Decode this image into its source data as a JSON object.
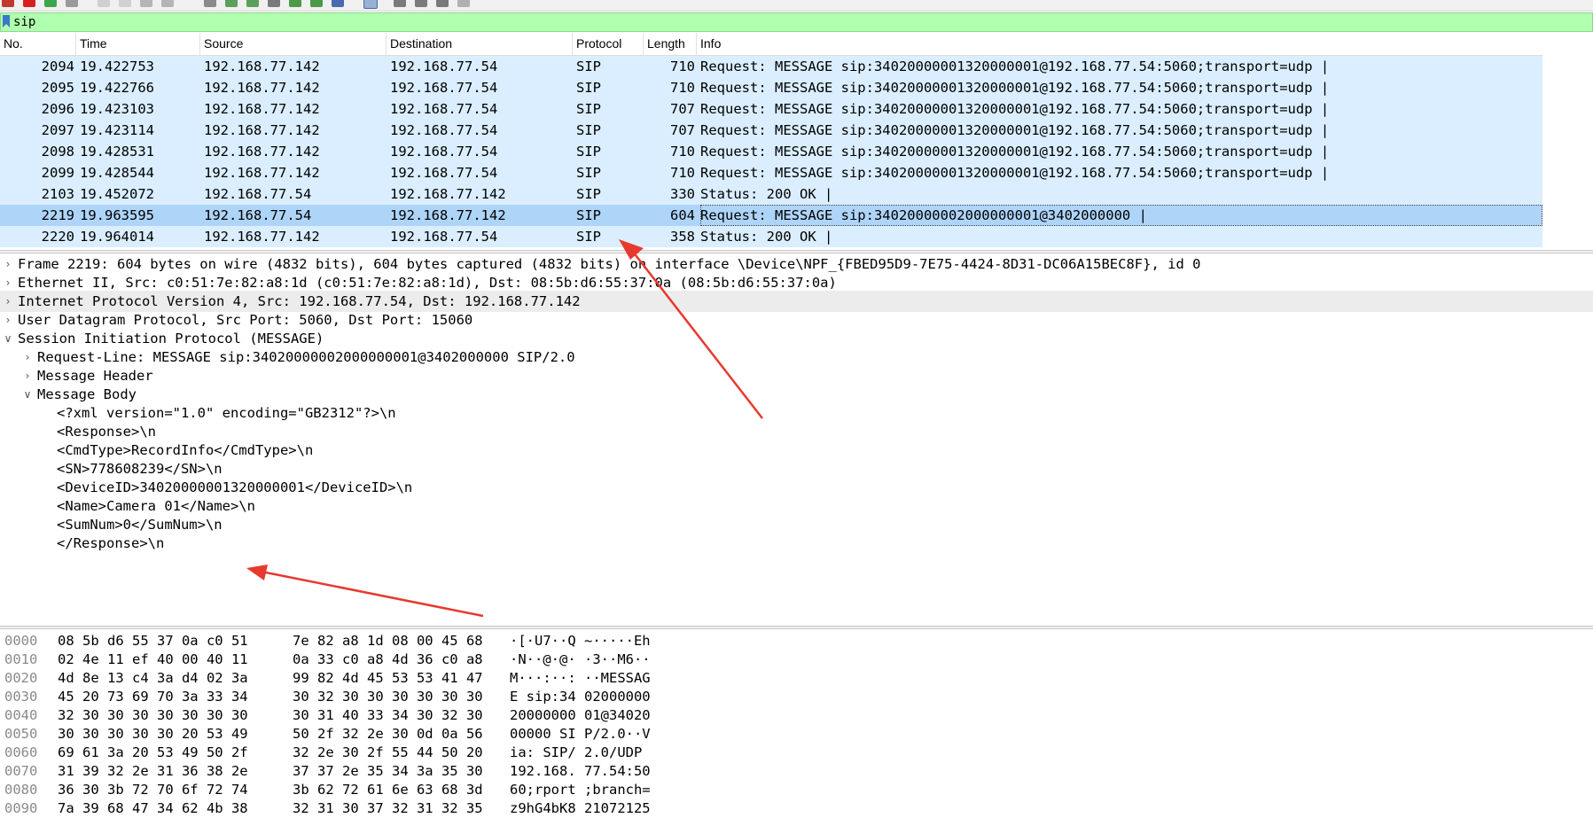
{
  "filter": {
    "value": "sip"
  },
  "packet_list": {
    "columns": [
      "No.",
      "Time",
      "Source",
      "Destination",
      "Protocol",
      "Length",
      "Info"
    ],
    "rows": [
      {
        "no": "2094",
        "time": "19.422753",
        "src": "192.168.77.142",
        "dst": "192.168.77.54",
        "proto": "SIP",
        "len": "710",
        "info": "Request: MESSAGE sip:34020000001320000001@192.168.77.54:5060;transport=udp  |"
      },
      {
        "no": "2095",
        "time": "19.422766",
        "src": "192.168.77.142",
        "dst": "192.168.77.54",
        "proto": "SIP",
        "len": "710",
        "info": "Request: MESSAGE sip:34020000001320000001@192.168.77.54:5060;transport=udp  |"
      },
      {
        "no": "2096",
        "time": "19.423103",
        "src": "192.168.77.142",
        "dst": "192.168.77.54",
        "proto": "SIP",
        "len": "707",
        "info": "Request: MESSAGE sip:34020000001320000001@192.168.77.54:5060;transport=udp  |"
      },
      {
        "no": "2097",
        "time": "19.423114",
        "src": "192.168.77.142",
        "dst": "192.168.77.54",
        "proto": "SIP",
        "len": "707",
        "info": "Request: MESSAGE sip:34020000001320000001@192.168.77.54:5060;transport=udp  |"
      },
      {
        "no": "2098",
        "time": "19.428531",
        "src": "192.168.77.142",
        "dst": "192.168.77.54",
        "proto": "SIP",
        "len": "710",
        "info": "Request: MESSAGE sip:34020000001320000001@192.168.77.54:5060;transport=udp  |"
      },
      {
        "no": "2099",
        "time": "19.428544",
        "src": "192.168.77.142",
        "dst": "192.168.77.54",
        "proto": "SIP",
        "len": "710",
        "info": "Request: MESSAGE sip:34020000001320000001@192.168.77.54:5060;transport=udp  |"
      },
      {
        "no": "2103",
        "time": "19.452072",
        "src": "192.168.77.54",
        "dst": "192.168.77.142",
        "proto": "SIP",
        "len": "330",
        "info": "Status: 200 OK  |"
      },
      {
        "no": "2219",
        "time": "19.963595",
        "src": "192.168.77.54",
        "dst": "192.168.77.142",
        "proto": "SIP",
        "len": "604",
        "info": "Request: MESSAGE sip:34020000002000000001@3402000000  |"
      },
      {
        "no": "2220",
        "time": "19.964014",
        "src": "192.168.77.142",
        "dst": "192.168.77.54",
        "proto": "SIP",
        "len": "358",
        "info": "Status: 200 OK  |"
      }
    ],
    "selected_no": "2219"
  },
  "details": {
    "lines": [
      {
        "twisty": ">",
        "text": "Frame 2219: 604 bytes on wire (4832 bits), 604 bytes captured (4832 bits) on interface \\Device\\NPF_{FBED95D9-7E75-4424-8D31-DC06A15BEC8F}, id 0"
      },
      {
        "twisty": ">",
        "text": "Ethernet II, Src: c0:51:7e:82:a8:1d (c0:51:7e:82:a8:1d), Dst: 08:5b:d6:55:37:0a (08:5b:d6:55:37:0a)"
      },
      {
        "twisty": ">",
        "text": "Internet Protocol Version 4, Src: 192.168.77.54, Dst: 192.168.77.142"
      },
      {
        "twisty": ">",
        "text": "User Datagram Protocol, Src Port: 5060, Dst Port: 15060"
      },
      {
        "twisty": "v",
        "text": "Session Initiation Protocol (MESSAGE)"
      },
      {
        "twisty": ">",
        "text": "Request-Line: MESSAGE sip:34020000002000000001@3402000000 SIP/2.0"
      },
      {
        "twisty": ">",
        "text": "Message Header"
      },
      {
        "twisty": "v",
        "text": "Message Body"
      },
      {
        "twisty": "",
        "text": "<?xml version=\"1.0\" encoding=\"GB2312\"?>\\n"
      },
      {
        "twisty": "",
        "text": "<Response>\\n"
      },
      {
        "twisty": "",
        "text": "<CmdType>RecordInfo</CmdType>\\n"
      },
      {
        "twisty": "",
        "text": "<SN>778608239</SN>\\n"
      },
      {
        "twisty": "",
        "text": "<DeviceID>34020000001320000001</DeviceID>\\n"
      },
      {
        "twisty": "",
        "text": "<Name>Camera 01</Name>\\n"
      },
      {
        "twisty": "",
        "text": "<SumNum>0</SumNum>\\n"
      },
      {
        "twisty": "",
        "text": "</Response>\\n"
      }
    ]
  },
  "bytes": {
    "rows": [
      {
        "off": "0000",
        "h1": "08 5b d6 55 37 0a c0 51",
        "h2": "7e 82 a8 1d 08 00 45 68",
        "ascii": "·[·U7··Q ~·····Eh"
      },
      {
        "off": "0010",
        "h1": "02 4e 11 ef 40 00 40 11",
        "h2": "0a 33 c0 a8 4d 36 c0 a8",
        "ascii": "·N··@·@· ·3··M6··"
      },
      {
        "off": "0020",
        "h1": "4d 8e 13 c4 3a d4 02 3a",
        "h2": "99 82 4d 45 53 53 41 47",
        "ascii": "M···:··: ··MESSAG"
      },
      {
        "off": "0030",
        "h1": "45 20 73 69 70 3a 33 34",
        "h2": "30 32 30 30 30 30 30 30",
        "ascii": "E sip:34 02000000"
      },
      {
        "off": "0040",
        "h1": "32 30 30 30 30 30 30 30",
        "h2": "30 31 40 33 34 30 32 30",
        "ascii": "20000000 01@34020"
      },
      {
        "off": "0050",
        "h1": "30 30 30 30 30 20 53 49",
        "h2": "50 2f 32 2e 30 0d 0a 56",
        "ascii": "00000 SI P/2.0··V"
      },
      {
        "off": "0060",
        "h1": "69 61 3a 20 53 49 50 2f",
        "h2": "32 2e 30 2f 55 44 50 20",
        "ascii": "ia: SIP/ 2.0/UDP "
      },
      {
        "off": "0070",
        "h1": "31 39 32 2e 31 36 38 2e",
        "h2": "37 37 2e 35 34 3a 35 30",
        "ascii": "192.168. 77.54:50"
      },
      {
        "off": "0080",
        "h1": "36 30 3b 72 70 6f 72 74",
        "h2": "3b 62 72 61 6e 63 68 3d",
        "ascii": "60;rport ;branch="
      },
      {
        "off": "0090",
        "h1": "7a 39 68 47 34 62 4b 38",
        "h2": "32 31 30 37 32 31 32 35",
        "ascii": "z9hG4bK8 21072125"
      }
    ]
  },
  "colors": {
    "filter_bg": "#afffaf",
    "row_bg": "#daeeff",
    "row_selected_bg": "#aed4f8",
    "arrow": "#e8392f"
  }
}
